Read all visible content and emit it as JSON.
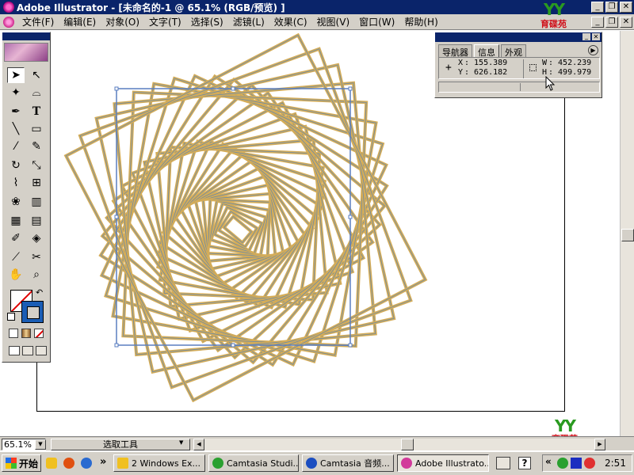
{
  "window": {
    "title": "Adobe Illustrator - [未命名的-1 @ 65.1% (RGB/预览) ]",
    "min": "_",
    "restore": "❐",
    "close": "✕"
  },
  "menu": [
    "文件(F)",
    "编辑(E)",
    "对象(O)",
    "文字(T)",
    "选择(S)",
    "滤镜(L)",
    "效果(C)",
    "视图(V)",
    "窗口(W)",
    "帮助(H)"
  ],
  "watermark": {
    "letters": "YY",
    "text": "育碟苑"
  },
  "tools": {
    "selection": "➤",
    "direct_selection": "↖",
    "magic_wand": "✦",
    "lasso": "⌓",
    "pen": "✒",
    "type": "T",
    "line": "╲",
    "rectangle": "▭",
    "paintbrush": "⁄",
    "pencil": "✎",
    "rotate": "↻",
    "scale": "⤡",
    "warp": "⌇",
    "free_transform": "⊞",
    "symbol_sprayer": "❀",
    "graph": "▥",
    "mesh": "▦",
    "gradient": "▤",
    "eyedropper": "✐",
    "blend": "◈",
    "slice": "⟋",
    "scissors": "✂",
    "hand": "✋",
    "zoom": "⌕",
    "swap_arrow": "↶"
  },
  "info_panel": {
    "tabs": [
      "导航器",
      "信息",
      "外观"
    ],
    "active_tab": "信息",
    "x_label": "X",
    "x_value": ": 155.389",
    "y_label": "Y",
    "y_value": ": 626.182",
    "w_label": "W",
    "w_value": ": 452.239",
    "h_label": "H",
    "h_value": ": 499.979",
    "menu_arrow": "▶"
  },
  "status": {
    "zoom": "65.1%",
    "dropdown_arrow": "▼",
    "tool_name": "选取工具",
    "left_arrow": "◀",
    "right_arrow": "▶"
  },
  "taskbar": {
    "start": "开始",
    "chevron": "»",
    "items": [
      {
        "label": "2 Windows Ex...",
        "active": false
      },
      {
        "label": "Camtasia Studi...",
        "active": false
      },
      {
        "label": "Camtasia 音频...",
        "active": false
      },
      {
        "label": "Adobe Illustrato...",
        "active": true
      }
    ],
    "tray_chevron": "«",
    "clock": "2:51"
  },
  "colors": {
    "titlebar": "#0a246a",
    "chrome": "#d4d0c8",
    "artwork_stroke": "#d4ac58",
    "selection_box": "#5a7ec0"
  }
}
